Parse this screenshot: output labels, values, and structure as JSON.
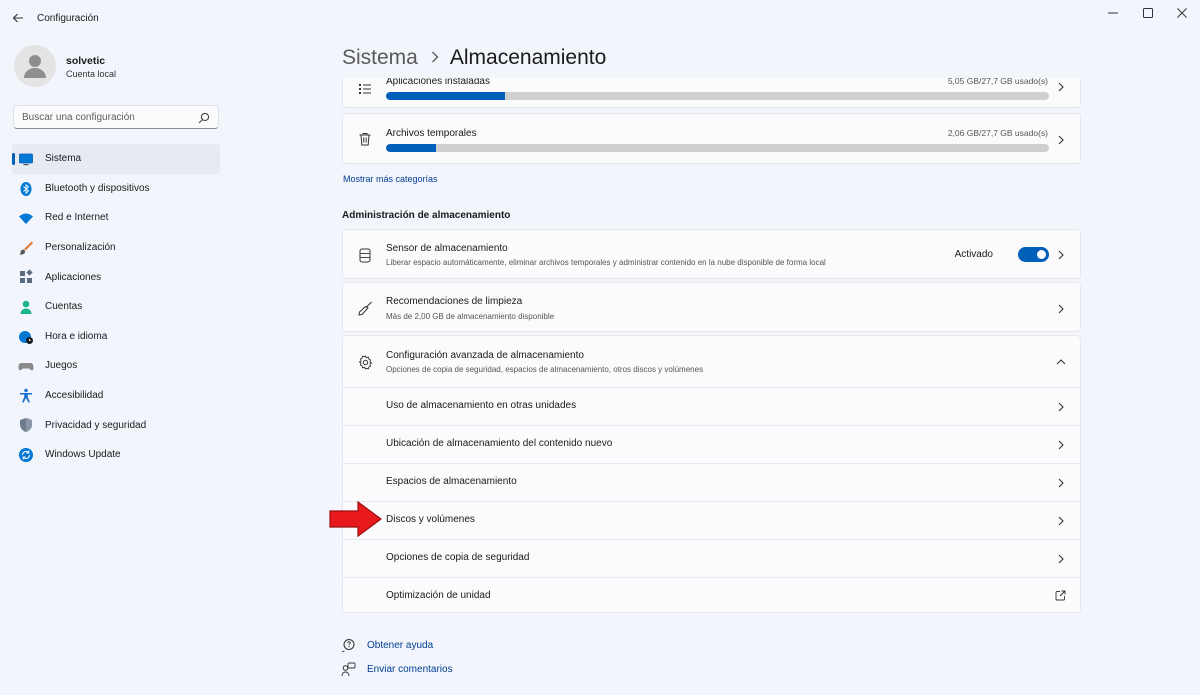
{
  "app": {
    "title": "Configuración"
  },
  "user": {
    "name": "solvetic",
    "account_type": "Cuenta local"
  },
  "search": {
    "placeholder": "Buscar una configuración"
  },
  "nav": {
    "items": [
      {
        "label": "Sistema",
        "icon": "monitor-icon",
        "active": true
      },
      {
        "label": "Bluetooth y dispositivos",
        "icon": "bluetooth-icon"
      },
      {
        "label": "Red e Internet",
        "icon": "wifi-icon"
      },
      {
        "label": "Personalización",
        "icon": "brush-icon"
      },
      {
        "label": "Aplicaciones",
        "icon": "apps-icon"
      },
      {
        "label": "Cuentas",
        "icon": "person-icon"
      },
      {
        "label": "Hora e idioma",
        "icon": "globe-clock-icon"
      },
      {
        "label": "Juegos",
        "icon": "gamepad-icon"
      },
      {
        "label": "Accesibilidad",
        "icon": "accessibility-icon"
      },
      {
        "label": "Privacidad y seguridad",
        "icon": "shield-icon"
      },
      {
        "label": "Windows Update",
        "icon": "update-icon"
      }
    ]
  },
  "breadcrumb": {
    "parent": "Sistema",
    "current": "Almacenamiento"
  },
  "storage": {
    "categories": [
      {
        "label": "Aplicaciones instaladas",
        "usage": "5,05 GB/27,7 GB usado(s)",
        "fill_fraction": 0.18,
        "icon": "list-icon"
      },
      {
        "label": "Archivos temporales",
        "usage": "2,06 GB/27,7 GB usado(s)",
        "fill_fraction": 0.075,
        "icon": "trash-icon"
      }
    ],
    "show_more": "Mostrar más categorías"
  },
  "management": {
    "title": "Administración de almacenamiento",
    "sensor": {
      "title": "Sensor de almacenamiento",
      "subtitle": "Liberar espacio automáticamente, eliminar archivos temporales y administrar contenido en la nube disponible de forma local",
      "state_label": "Activado",
      "enabled": true
    },
    "cleanup": {
      "title": "Recomendaciones de limpieza",
      "subtitle": "Más de 2,00 GB de almacenamiento disponible"
    },
    "advanced": {
      "title": "Configuración avanzada de almacenamiento",
      "subtitle": "Opciones de copia de seguridad, espacios de almacenamiento, otros discos y volúmenes",
      "items": [
        {
          "label": "Uso de almacenamiento en otras unidades",
          "icon": "chevron-right-icon"
        },
        {
          "label": "Ubicación de almacenamiento del contenido nuevo",
          "icon": "chevron-right-icon"
        },
        {
          "label": "Espacios de almacenamiento",
          "icon": "chevron-right-icon"
        },
        {
          "label": "Discos y volúmenes",
          "icon": "chevron-right-icon"
        },
        {
          "label": "Opciones de copia de seguridad",
          "icon": "chevron-right-icon"
        },
        {
          "label": "Optimización de unidad",
          "icon": "external-link-icon"
        }
      ]
    }
  },
  "footer": {
    "help": "Obtener ayuda",
    "feedback": "Enviar comentarios"
  },
  "colors": {
    "accent": "#005fb8",
    "link": "#003e92",
    "arrow": "#e8191c"
  }
}
